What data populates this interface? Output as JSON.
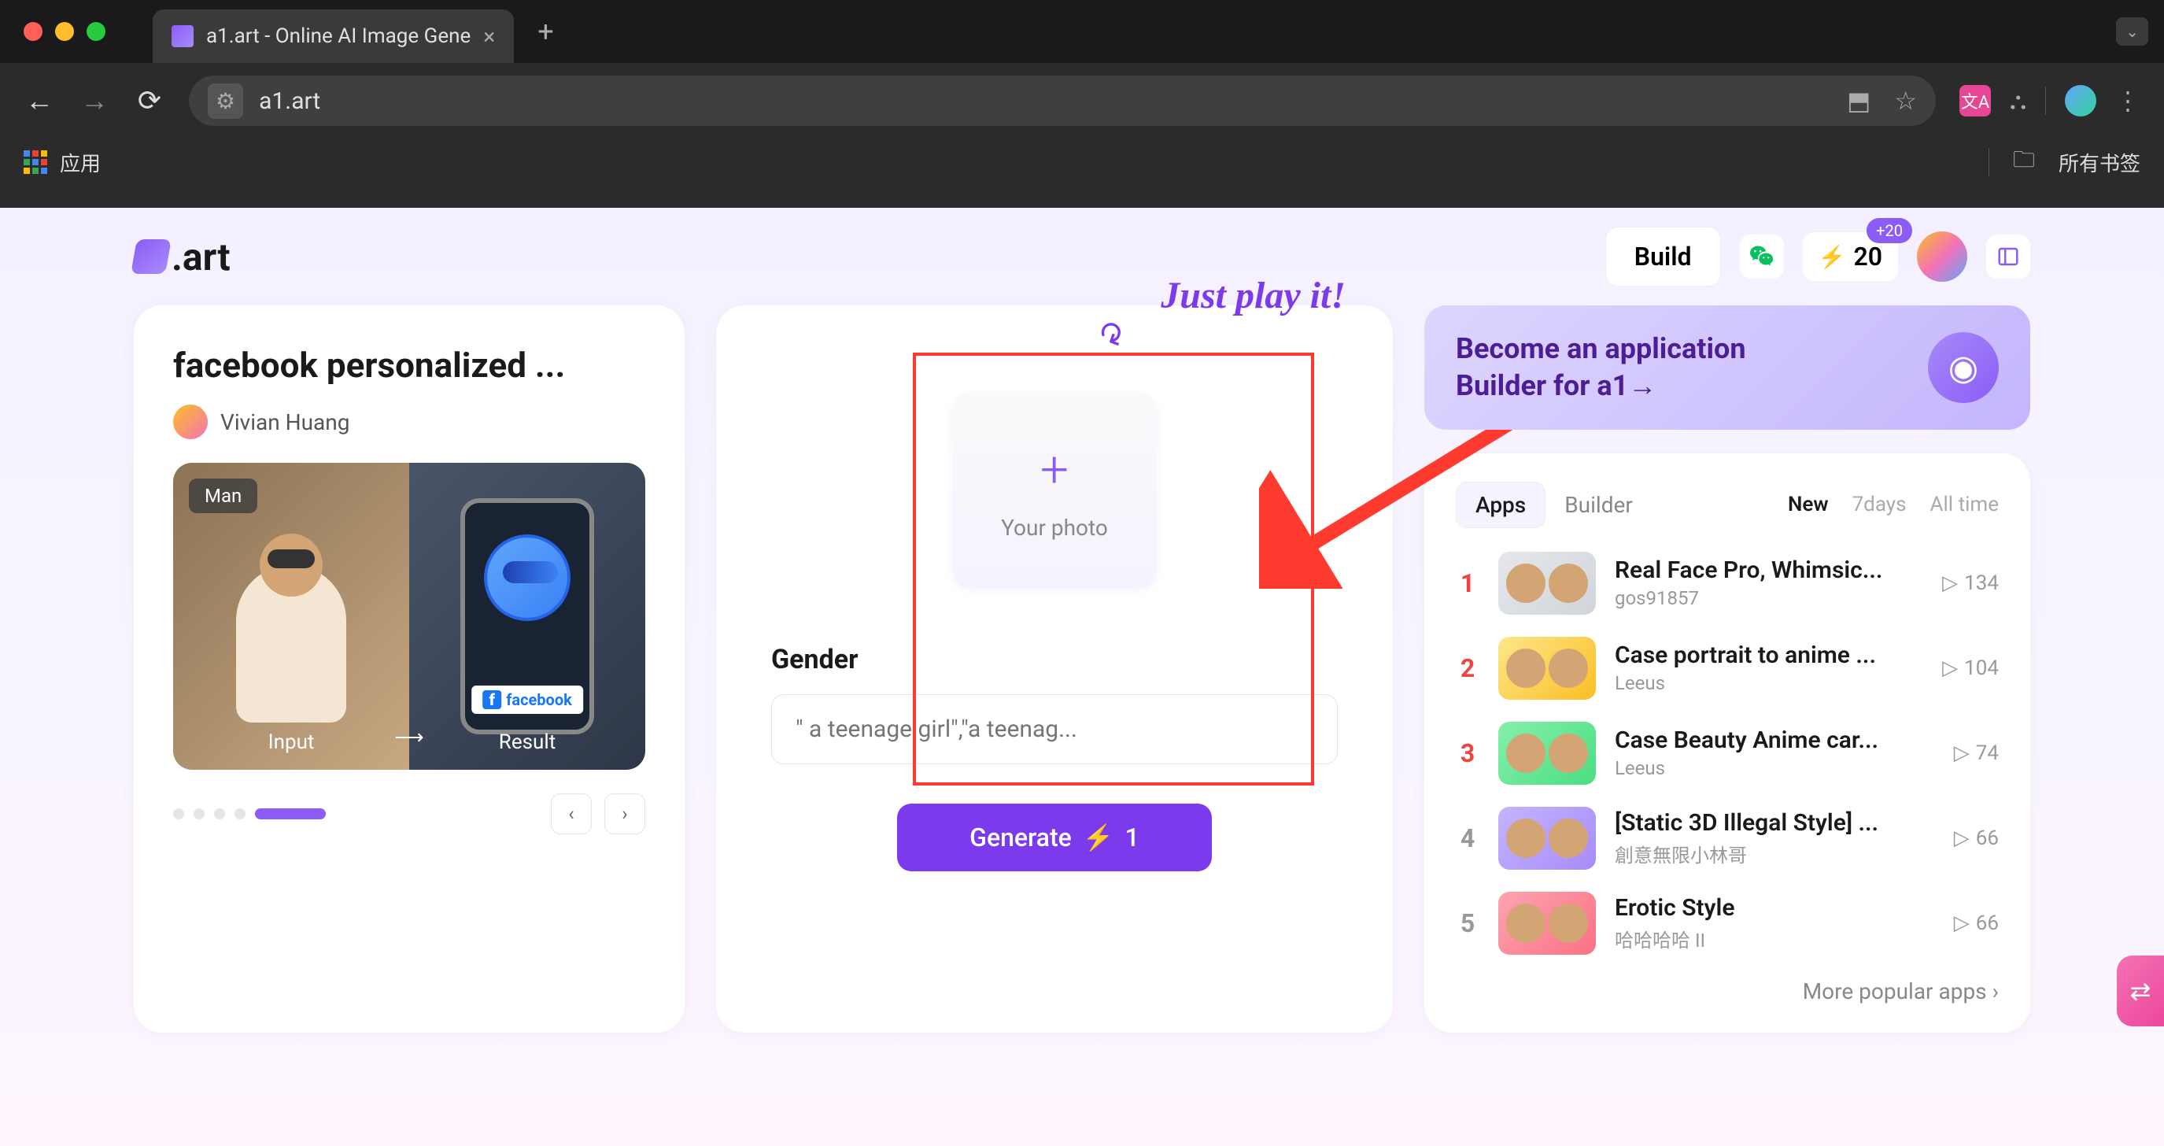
{
  "browser": {
    "tab_title": "a1.art - Online AI Image Gene",
    "url": "a1.art",
    "bookmarks": {
      "apps": "应用",
      "all": "所有书签"
    }
  },
  "topbar": {
    "logo": ".art",
    "build": "Build",
    "credits": "20",
    "credits_badge": "+20"
  },
  "left": {
    "title": "facebook personalized ...",
    "author": "Vivian Huang",
    "badge": "Man",
    "input_label": "Input",
    "result_label": "Result",
    "fb": "facebook"
  },
  "middle": {
    "play": "Just play it!",
    "upload": "Your photo",
    "gender": "Gender",
    "gender_placeholder": "\" a teenage girl\",\"a teenag...",
    "generate": "Generate",
    "generate_cost": "1"
  },
  "right": {
    "banner_line1": "Become an application",
    "banner_line2": "Builder for a1→",
    "tabs": {
      "apps": "Apps",
      "builder": "Builder"
    },
    "filters": {
      "new": "New",
      "week": "7days",
      "all": "All time"
    },
    "apps": [
      {
        "rank": "1",
        "title": "Real Face Pro, Whimsic...",
        "author": "gos91857",
        "runs": "134"
      },
      {
        "rank": "2",
        "title": "Case portrait to anime ...",
        "author": "Leeus",
        "runs": "104"
      },
      {
        "rank": "3",
        "title": "Case Beauty Anime car...",
        "author": "Leeus",
        "runs": "74"
      },
      {
        "rank": "4",
        "title": "[Static 3D Illegal Style] ...",
        "author": "創意無限小林哥",
        "runs": "66"
      },
      {
        "rank": "5",
        "title": "Erotic Style",
        "author": "哈哈哈哈 II",
        "runs": "66"
      }
    ],
    "more": "More popular apps"
  }
}
